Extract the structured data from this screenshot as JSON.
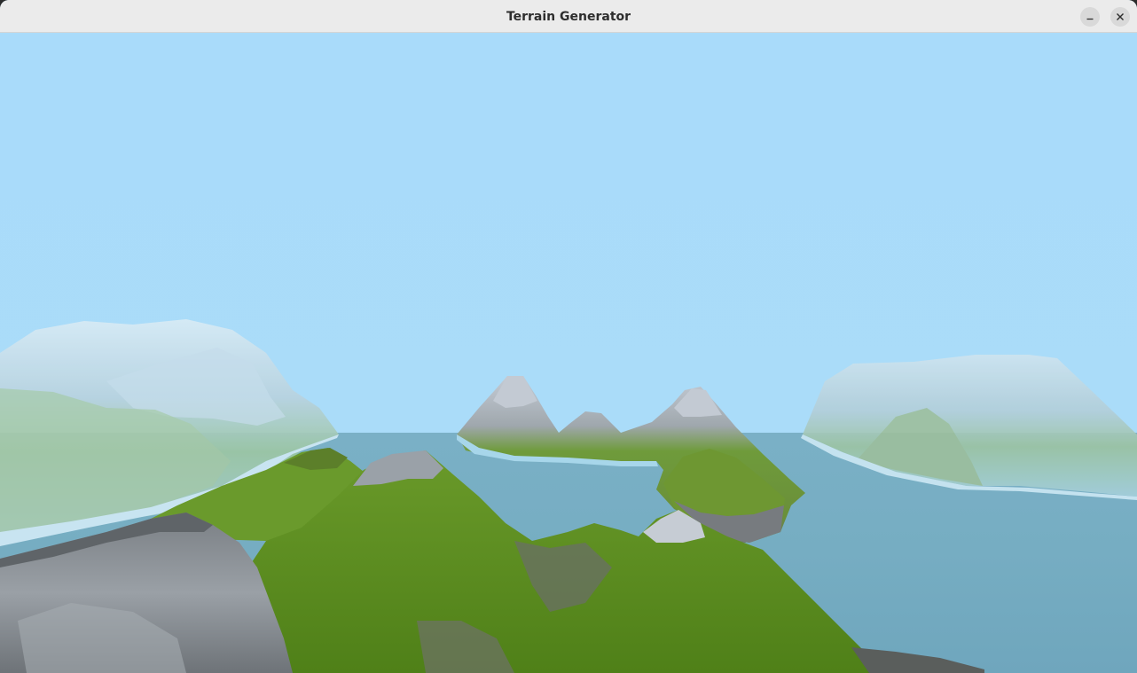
{
  "window": {
    "title": "Terrain Generator",
    "minimize_icon": "minimize-icon",
    "close_icon": "close-icon"
  },
  "scene": {
    "sky_color": "#abdcf9",
    "water_color": "#7cb4c8",
    "grass_color": "#5e8f1e",
    "rock_color": "#8f959a",
    "snow_color": "#c4ccd6"
  }
}
